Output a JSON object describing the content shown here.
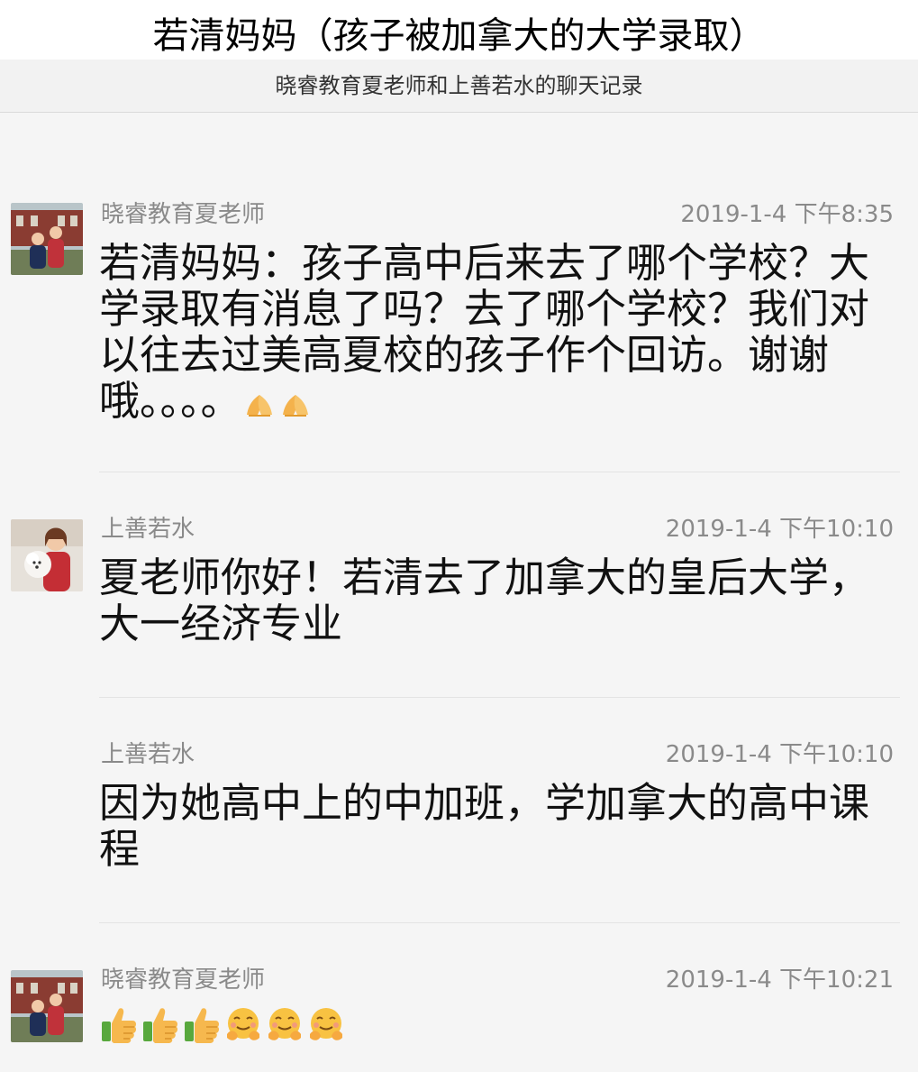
{
  "page": {
    "title": "若清妈妈（孩子被加拿大的大学录取）"
  },
  "chat": {
    "header_title": "晓睿教育夏老师和上善若水的聊天记录",
    "messages": [
      {
        "sender": "晓睿教育夏老师",
        "time": "2019-1-4 下午8:35",
        "text": "若清妈妈：孩子高中后来去了哪个学校？大学录取有消息了吗？去了哪个学校？我们对以往去过美高夏校的孩子作个回访。谢谢哦。。。。",
        "emojis": [
          "folded-hands",
          "folded-hands"
        ],
        "avatar": "teacher-avatar"
      },
      {
        "sender": "上善若水",
        "time": "2019-1-4 下午10:10",
        "text": "夏老师你好！若清去了加拿大的皇后大学，大一经济专业",
        "avatar": "parent-avatar"
      },
      {
        "sender": "上善若水",
        "time": "2019-1-4 下午10:10",
        "text": "因为她高中上的中加班，学加拿大的高中课程"
      },
      {
        "sender": "晓睿教育夏老师",
        "time": "2019-1-4 下午10:21",
        "text": "",
        "emojis": [
          "thumbs-up",
          "thumbs-up",
          "thumbs-up",
          "hug",
          "hug",
          "hug"
        ],
        "avatar": "teacher-avatar"
      }
    ]
  },
  "colors": {
    "background": "#f5f5f5",
    "meta_text": "#8a8a8a",
    "body_text": "#111111",
    "divider": "#e3e3e3"
  }
}
